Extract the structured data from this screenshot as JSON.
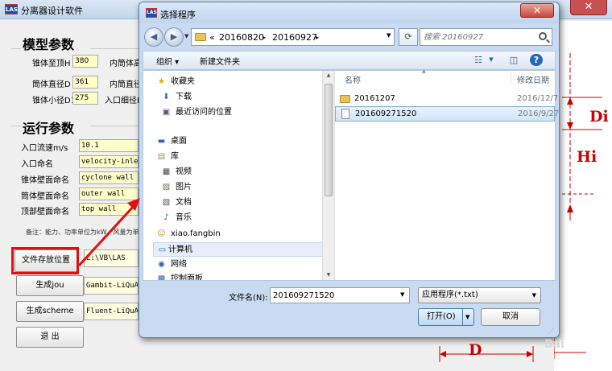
{
  "app": {
    "logo": "LAS",
    "title": "分离器设计软件",
    "close_glyph": "✕"
  },
  "model_params": {
    "title": "模型参数",
    "fields": [
      {
        "label": "锥体至顶H",
        "value": "380",
        "label2": "内筒体高"
      },
      {
        "label": "筒体直径D",
        "value": "361",
        "label2": "内筒直径"
      },
      {
        "label": "锥体小径D1",
        "value": "275",
        "label2": "入口细径R"
      }
    ]
  },
  "run_params": {
    "title": "运行参数",
    "fields": [
      {
        "label": "入口流速m/s",
        "value": "10.1"
      },
      {
        "label": "入口命名",
        "value": "velocity-inlet"
      },
      {
        "label": "锥体壁面命名",
        "value": "cyclone wall"
      },
      {
        "label": "筒体壁面命名",
        "value": "outer wall"
      },
      {
        "label": "顶部壁面命名",
        "value": "top wall"
      }
    ],
    "note": "备注：能力、功率单位为kW，风量为单"
  },
  "actions": [
    {
      "label": "文件存放位置",
      "output": "E:\\VB\\LAS"
    },
    {
      "label": "生成jou",
      "output": "Gambit-LiQuA"
    },
    {
      "label": "生成scheme",
      "output": "Fluent-LiQuA"
    },
    {
      "label": "退  出",
      "output": ""
    }
  ],
  "diagram": {
    "labels": {
      "di": "Di",
      "hi": "Hi",
      "d": "D"
    },
    "color": "#cc0000"
  },
  "dialog": {
    "title": "选择程序",
    "close_glyph": "✕",
    "breadcrumbs": [
      "«",
      "20160820",
      "▸",
      "20160927",
      "▸"
    ],
    "search_placeholder": "搜索 20160927",
    "toolbar": {
      "organize": "组织 ▾",
      "new_folder": "新建文件夹"
    },
    "nav": [
      {
        "icon": "★",
        "label": "收藏夹",
        "indent": 0
      },
      {
        "icon": "⬇",
        "label": "下载",
        "indent": 1
      },
      {
        "icon": "▣",
        "label": "最近访问的位置",
        "indent": 1
      },
      {
        "icon": "▬",
        "label": "桌面",
        "indent": 0
      },
      {
        "icon": "▤",
        "label": "库",
        "indent": 0
      },
      {
        "icon": "▦",
        "label": "视频",
        "indent": 1
      },
      {
        "icon": "▨",
        "label": "图片",
        "indent": 1
      },
      {
        "icon": "▧",
        "label": "文档",
        "indent": 1
      },
      {
        "icon": "♪",
        "label": "音乐",
        "indent": 1
      },
      {
        "icon": "☺",
        "label": "xiao.fangbin",
        "indent": 0
      },
      {
        "icon": "▭",
        "label": "计算机",
        "indent": 0
      },
      {
        "icon": "◉",
        "label": "网络",
        "indent": 0
      },
      {
        "icon": "▩",
        "label": "控制面板",
        "indent": 0
      }
    ],
    "columns": {
      "name": "名称",
      "date": "修改日期"
    },
    "files": [
      {
        "type": "folder",
        "name": "20161207",
        "date": "2016/12/7"
      },
      {
        "type": "file",
        "name": "201609271520",
        "date": "2016/9/27"
      }
    ],
    "filename_label": "文件名(N):",
    "filename_value": "201609271520",
    "filetype": "应用程序(*.txt)",
    "open_label": "打开(O)",
    "cancel_label": "取消"
  },
  "watermark": "Bai"
}
